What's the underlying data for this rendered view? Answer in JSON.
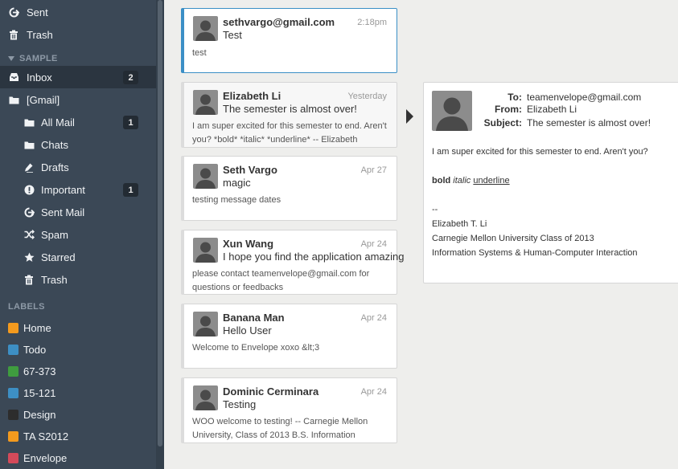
{
  "sidebar": {
    "top_items": [
      {
        "label": "Sent",
        "icon": "sent-icon"
      },
      {
        "label": "Trash",
        "icon": "trash-icon"
      }
    ],
    "sample_section": "SAMPLE",
    "sample_items": [
      {
        "label": "Inbox",
        "icon": "inbox-icon",
        "badge": "2"
      },
      {
        "label": "[Gmail]",
        "icon": "folder-icon"
      }
    ],
    "gmail_items": [
      {
        "label": "All Mail",
        "icon": "folder-icon",
        "badge": "1"
      },
      {
        "label": "Chats",
        "icon": "folder-icon"
      },
      {
        "label": "Drafts",
        "icon": "pencil-icon"
      },
      {
        "label": "Important",
        "icon": "exclamation-icon",
        "badge": "1"
      },
      {
        "label": "Sent Mail",
        "icon": "sent-icon"
      },
      {
        "label": "Spam",
        "icon": "shuffle-icon"
      },
      {
        "label": "Starred",
        "icon": "star-icon"
      },
      {
        "label": "Trash",
        "icon": "trash-icon"
      }
    ],
    "labels_section": "LABELS",
    "labels": [
      {
        "label": "Home",
        "color": "#f39a1e"
      },
      {
        "label": "Todo",
        "color": "#3d8fc4"
      },
      {
        "label": "67-373",
        "color": "#3f9c3f"
      },
      {
        "label": "15-121",
        "color": "#3d8fc4"
      },
      {
        "label": "Design",
        "color": "#2d2d2d"
      },
      {
        "label": "TA S2012",
        "color": "#f39a1e"
      },
      {
        "label": "Envelope",
        "color": "#d44a5a"
      }
    ]
  },
  "messages": [
    {
      "from": "sethvargo@gmail.com",
      "date": "2:18pm",
      "subject": "Test",
      "snippet": "test"
    },
    {
      "from": "Elizabeth Li",
      "date": "Yesterday",
      "subject": "The semester is almost over!",
      "snippet": "I am super excited for this semester to end. Aren't you? *bold* *italic* *underline* -- Elizabeth"
    },
    {
      "from": "Seth Vargo",
      "date": "Apr 27",
      "subject": "magic",
      "snippet": "testing message dates"
    },
    {
      "from": "Xun Wang",
      "date": "Apr 24",
      "subject": "I hope you find the application amazing",
      "snippet": "please contact teamenvelope@gmail.com for questions or feedbacks"
    },
    {
      "from": "Banana Man",
      "date": "Apr 24",
      "subject": "Hello User",
      "snippet": "Welcome to Envelope xoxo &lt;3"
    },
    {
      "from": "Dominic Cerminara",
      "date": "Apr 24",
      "subject": "Testing",
      "snippet": "WOO welcome to testing! -- Carnegie Mellon University, Class of 2013 B.S. Information"
    }
  ],
  "reading_pane": {
    "to_label": "To:",
    "to": "teamenvelope@gmail.com",
    "from_label": "From:",
    "from": "Elizabeth Li",
    "subject_label": "Subject:",
    "subject": "The semester is almost over!",
    "body_line1": "I am super excited for this semester to end. Aren't you?",
    "body_bold": "bold",
    "body_italic": "italic",
    "body_underline": "underline",
    "sig_dashes": "--",
    "sig_name": "Elizabeth T. Li",
    "sig_school": "Carnegie Mellon University Class of 2013",
    "sig_dept": "Information Systems & Human-Computer Interaction"
  }
}
